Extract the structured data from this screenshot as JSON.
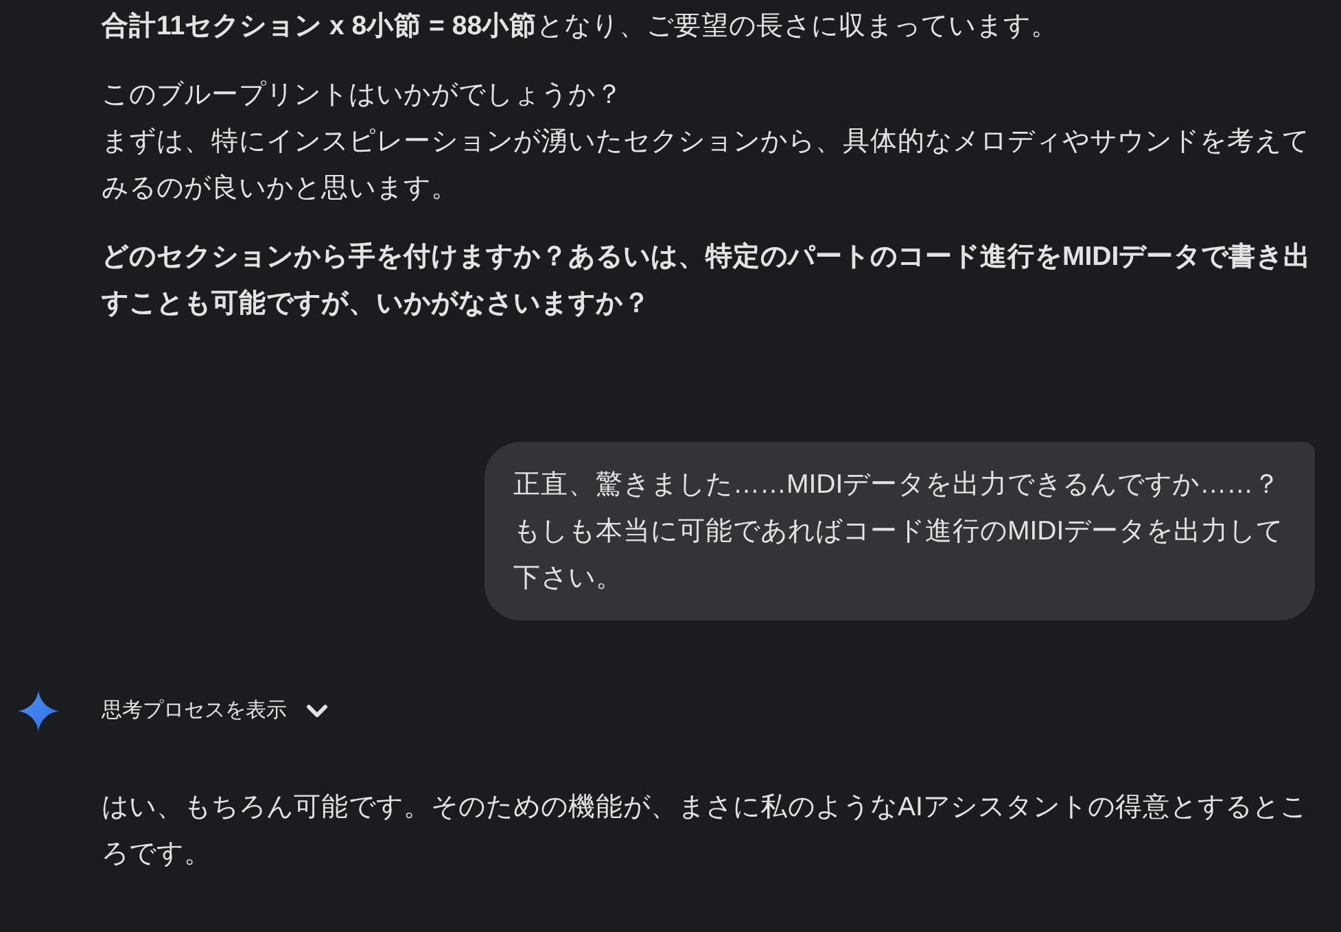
{
  "assistant_top": {
    "paragraphs": [
      {
        "bold": false,
        "lines": [
          "**合計11セクション x 8小節 = 88小節**となり、ご要望の長さに収まっています。"
        ]
      },
      {
        "bold": false,
        "lines": [
          "このブループリントはいかがでしょうか？",
          "まずは、特にインスピレーションが湧いたセクションから、具体的なメロディやサウンドを考えてみるのが良いかと思います。"
        ]
      },
      {
        "bold": true,
        "lines": [
          "どのセクションから手を付けますか？あるいは、特定のパートのコード進行をMIDIデータで書き出すことも可能ですが、いかがなさいますか？"
        ]
      }
    ]
  },
  "user_message": {
    "lines": [
      "正直、驚きました……MIDIデータを出力できるんですか……？",
      "もしも本当に可能であればコード進行のMIDIデータを出力して下さい。"
    ]
  },
  "thinking_toggle": {
    "label": "思考プロセスを表示",
    "expanded": false
  },
  "assistant_reply": {
    "paragraphs": [
      {
        "bold": false,
        "lines": [
          "はい、もちろん可能です。そのための機能が、まさに私のようなAIアシスタントの得意とするところです。"
        ]
      }
    ]
  }
}
